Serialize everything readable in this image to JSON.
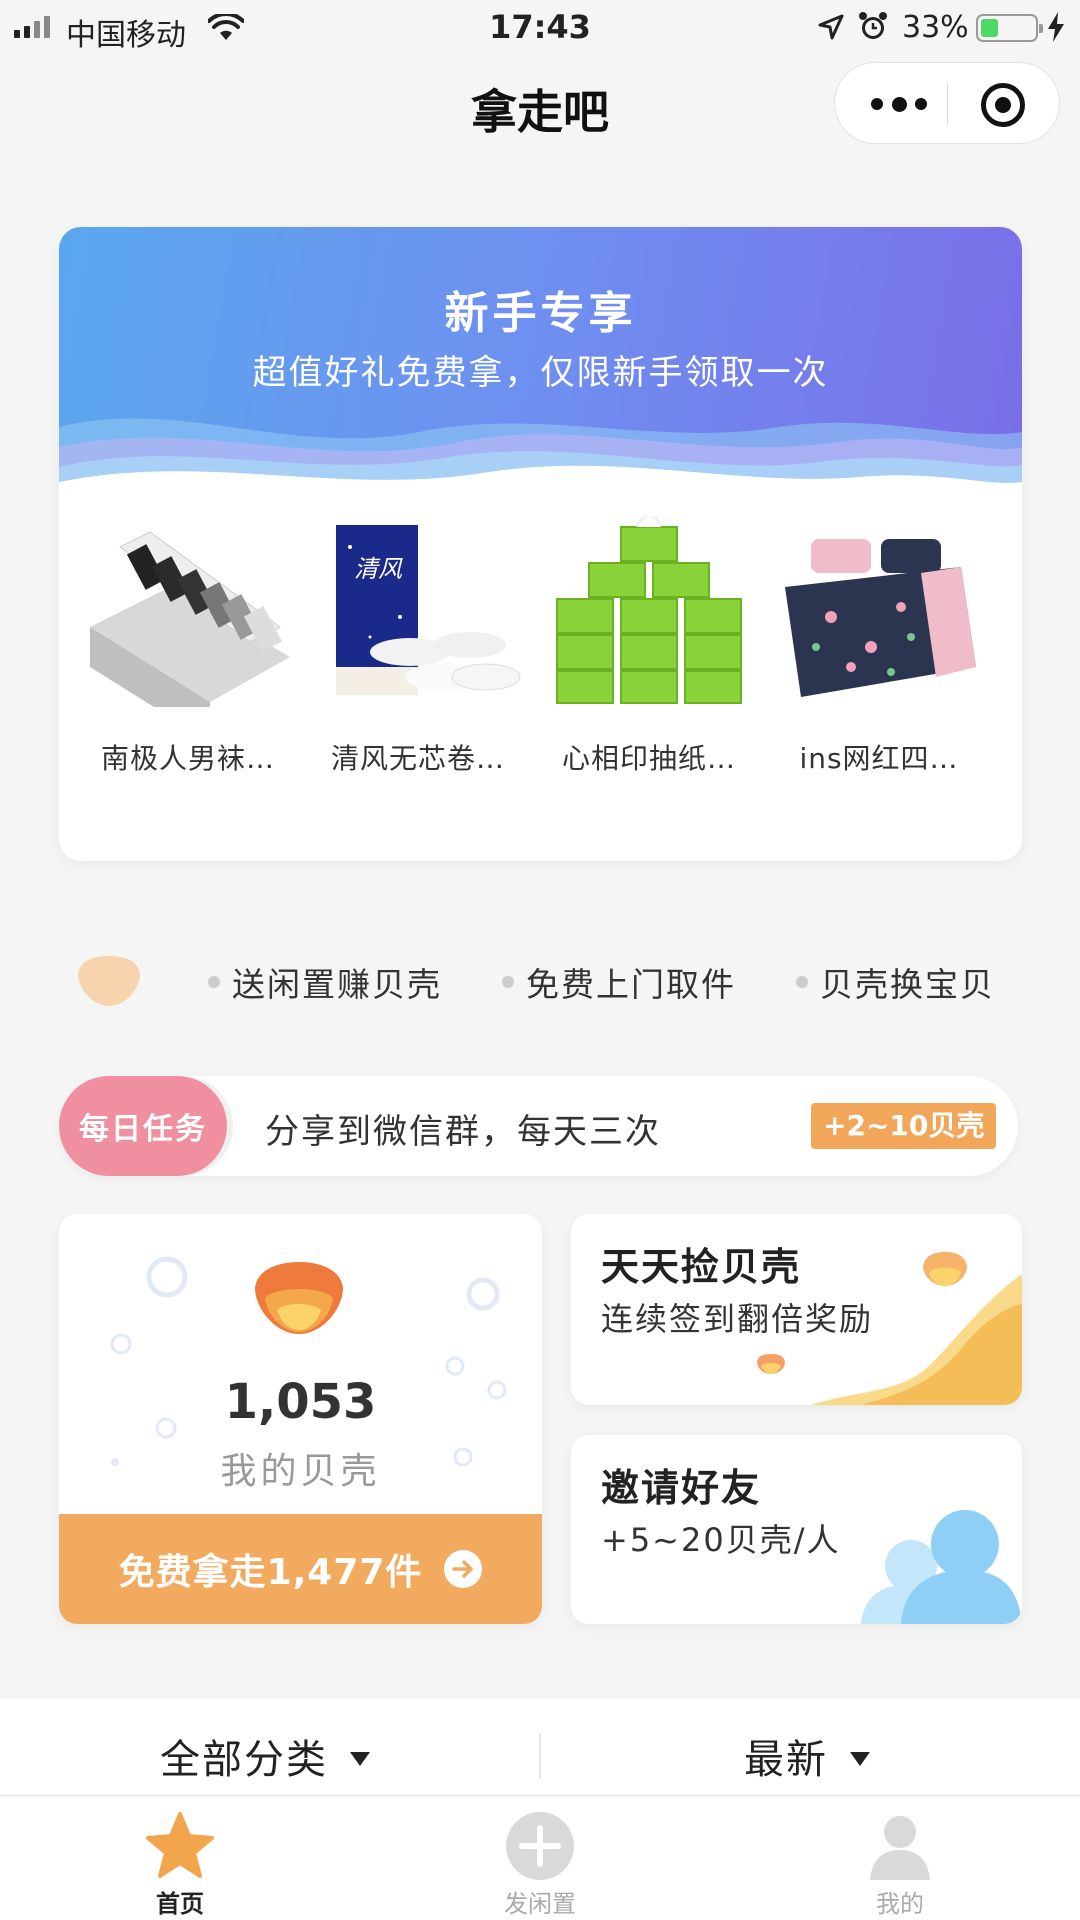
{
  "status_bar": {
    "carrier": "中国移动",
    "time": "17:43",
    "battery_pct": "33%",
    "battery_level": 0.33,
    "icons": [
      "signal-icon",
      "wifi-icon",
      "location-arrow-icon",
      "alarm-icon",
      "battery-icon",
      "charging-bolt-icon"
    ]
  },
  "nav": {
    "title": "拿走吧",
    "capsule_icons": [
      "more-dots-icon",
      "close-target-icon"
    ]
  },
  "newbie": {
    "title": "新手专享",
    "subtitle": "超值好礼免费拿，仅限新手领取一次",
    "products": [
      {
        "name": "南极人男袜…",
        "icon": "socks-box-image"
      },
      {
        "name": "清风无芯卷…",
        "icon": "toilet-paper-image"
      },
      {
        "name": "心相印抽纸…",
        "icon": "tissue-pack-image"
      },
      {
        "name": "ins网红四…",
        "icon": "bedding-set-image"
      }
    ],
    "colors": {
      "gradient_start": "#5aa7ee",
      "gradient_end": "#7a6ee8"
    }
  },
  "features": {
    "icon": "shell-icon",
    "items": [
      "送闲置赚贝壳",
      "免费上门取件",
      "贝壳换宝贝"
    ]
  },
  "daily_task": {
    "badge": "每日任务",
    "text": "分享到微信群，每天三次",
    "reward": "+2~10贝壳",
    "colors": {
      "badge": "#ef8f9f",
      "reward": "#f2a65a"
    }
  },
  "shell_card": {
    "count": "1,053",
    "label": "我的贝壳",
    "button": "免费拿走1,477件",
    "button_icon": "arrow-right-circle-icon",
    "colors": {
      "button": "#f2ab5e"
    }
  },
  "checkin_card": {
    "title": "天天捡贝壳",
    "subtitle": "连续签到翻倍奖励"
  },
  "invite_card": {
    "title": "邀请好友",
    "subtitle": "+5~20贝壳/人"
  },
  "filters": {
    "category": "全部分类",
    "sort": "最新"
  },
  "tabs": [
    {
      "label": "首页",
      "icon": "star-icon",
      "active": true
    },
    {
      "label": "发闲置",
      "icon": "plus-circle-icon",
      "active": false
    },
    {
      "label": "我的",
      "icon": "user-icon",
      "active": false
    }
  ]
}
